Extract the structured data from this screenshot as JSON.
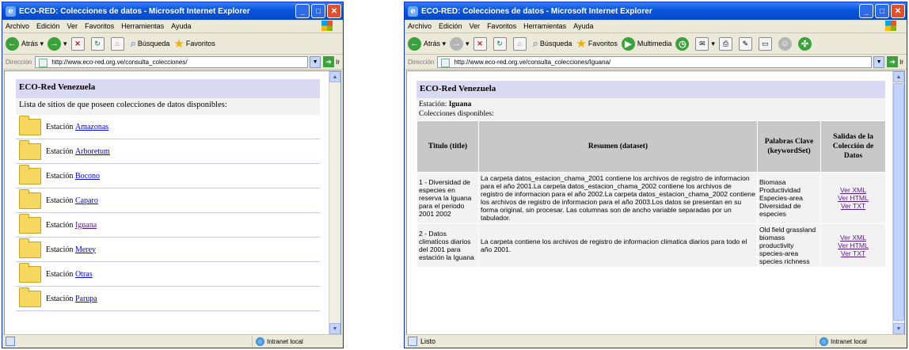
{
  "window1": {
    "title": "ECO-RED: Colecciones de datos - Microsoft Internet Explorer",
    "menu": [
      "Archivo",
      "Edición",
      "Ver",
      "Favoritos",
      "Herramientas",
      "Ayuda"
    ],
    "toolbar": {
      "back": "Atrás",
      "search": "Búsqueda",
      "favorites": "Favoritos"
    },
    "address_label": "Dirección",
    "address": "http://www.eco-red.org.ve/consulta_colecciones/",
    "go_label": "Ir",
    "status_zone": "Intranet local",
    "page": {
      "header": "ECO-Red Venezuela",
      "subtitle": "Lista de sitios de que poseen colecciones de datos disponibles:",
      "station_prefix": "Estación",
      "stations": [
        "Amazonas",
        "Arboretum",
        "Bocono",
        "Caparo",
        "Iguana",
        "Merey",
        "Otras",
        "Parupa"
      ]
    }
  },
  "window2": {
    "title": "ECO-RED: Colecciones de datos - Microsoft Internet Explorer",
    "menu": [
      "Archivo",
      "Edición",
      "Ver",
      "Favoritos",
      "Herramientas",
      "Ayuda"
    ],
    "toolbar": {
      "back": "Atrás",
      "search": "Búsqueda",
      "favorites": "Favoritos",
      "multimedia": "Multimedia"
    },
    "address_label": "Dirección",
    "address": "http://www.eco-red.org.ve/consulta_colecciones/Iguana/",
    "go_label": "Ir",
    "status_text": "Listo",
    "status_zone": "Intranet local",
    "page": {
      "header": "ECO-Red Venezuela",
      "station_label": "Estación:",
      "station_name": "Iguana",
      "collections_label": "Colecciones disponibles:",
      "columns": [
        "Titulo (title)",
        "Resumen (dataset)",
        "Palabras Clave (keywordSet)",
        "Salidas de la Colección de Datos"
      ],
      "rows": [
        {
          "title": "1 - Diversidad de especies en reserva la Iguana para el periodo 2001 2002",
          "summary": "La carpeta datos_estacion_chama_2001 contiene los archivos de registro de informacion para el año 2001.La carpeta datos_estacion_chama_2002 contiene los archivos de registro de informacion para el año 2002.La carpeta datos_estacion_chama_2002 contiene los archivos de registro de informacion para el año 2003.Los datos se presentan en su forma original, sin procesar. Las columnas son de ancho variable separadas por un tabulador.",
          "keywords": "Biomasa Productividad Especies-area Diversidad de especies",
          "links": [
            "Ver XML",
            "Ver HTML",
            "Ver TXT"
          ]
        },
        {
          "title": "2 - Datos climaticos diarios del 2001 para estación la Iguana",
          "summary": "La carpeta contiene los archivos de registro de informacion climatica diarios para todo el año 2001.",
          "keywords": "Old field grassland biomass productivity species-area species richness",
          "links": [
            "Ver XML",
            "Ver HTML",
            "Ver TXT"
          ]
        }
      ]
    }
  }
}
